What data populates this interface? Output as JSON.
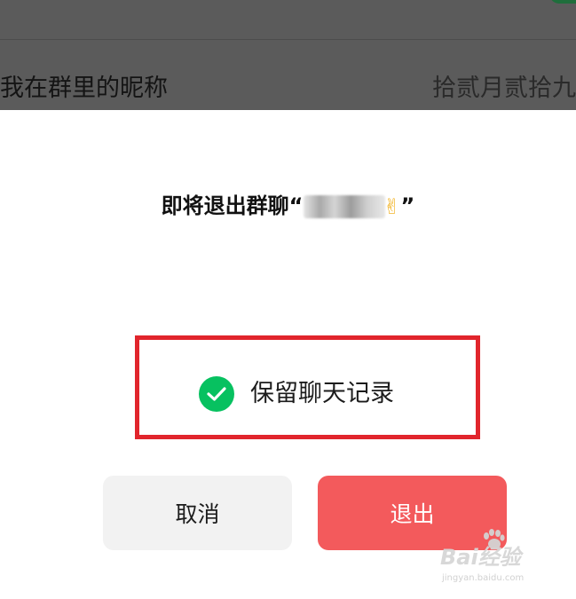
{
  "background_screen": {
    "row_label": "我在群里的昵称",
    "row_value": "拾贰月贰拾九"
  },
  "dialog": {
    "title_prefix": "即将退出群聊",
    "open_quote": "“",
    "close_quote": "”",
    "group_name_emoji": "✌",
    "keep_history_label": "保留聊天记录",
    "keep_history_checked": true,
    "cancel_label": "取消",
    "exit_label": "退出"
  },
  "watermark": {
    "main": "Bai经验",
    "sub": "jingyan.baidu.com"
  },
  "colors": {
    "accent_green": "#07c160",
    "exit_red": "#f35a5c",
    "highlight_red": "#e1252c",
    "cancel_bg": "#f2f2f2"
  }
}
